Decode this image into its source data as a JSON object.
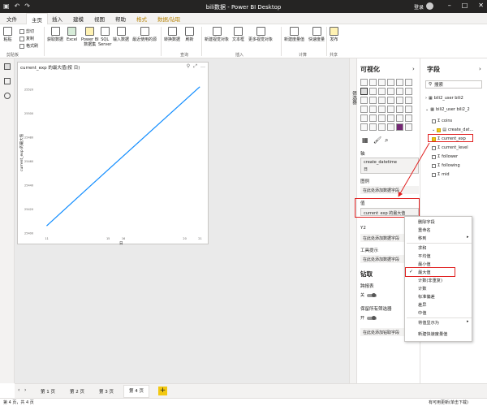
{
  "window": {
    "title": "bili数据 - Power BI Desktop",
    "login": "登录"
  },
  "tabs": [
    "文件",
    "主页",
    "插入",
    "建模",
    "视图",
    "帮助",
    "格式",
    "数据/钻取"
  ],
  "ribbon": {
    "paste": "粘贴",
    "cut": "剪切",
    "copy": "复制",
    "format_painter": "格式刷",
    "get_data": "获取数据",
    "excel": "Excel",
    "pbi_datasets": "Power BI\n数据集",
    "sql": "SQL\nServer",
    "enter_data": "输入数据",
    "recent": "最近使用的源",
    "transform": "转换数据",
    "refresh": "刷新",
    "new_visual": "新建视觉对象",
    "textbox": "文本框",
    "more_visuals": "更多视觉对象",
    "new_measure": "新建度量值",
    "quick_measure": "快速度量",
    "publish": "发布",
    "group_clipboard": "剪贴板",
    "group_query": "查询",
    "group_insert": "插入",
    "group_calc": "计算",
    "group_share": "共享"
  },
  "visual": {
    "title": "current_exp 的最大值(按 日)"
  },
  "chart_data": {
    "type": "line",
    "x": [
      11,
      14,
      15,
      16,
      17,
      18,
      19,
      20,
      21
    ],
    "y": [
      25420,
      25440,
      25450,
      25460,
      25470,
      25480,
      25490,
      25500,
      25510
    ],
    "xlabel": "日",
    "ylabel": "current_exp 的最大值",
    "xticks": [
      "11",
      "15",
      "16",
      "20",
      "21"
    ],
    "yticks": [
      "25400",
      "25420",
      "25440",
      "25460",
      "25480",
      "25500",
      "25520"
    ],
    "ylim": [
      25400,
      25530
    ],
    "series": [
      {
        "values": [
          [
            11,
            25406
          ],
          [
            14,
            25441
          ],
          [
            21,
            25522
          ]
        ]
      }
    ],
    "color": "#118dff"
  },
  "pages": [
    "第 1 页",
    "第 2 页",
    "第 3 页",
    "第 4 页"
  ],
  "status": {
    "left": "第 4 页，共 4 页",
    "right": "有可用更新(单击下载)"
  },
  "filters_label": "筛选器",
  "viz": {
    "title": "可视化",
    "axis_label": "轴",
    "axis_value": "create_datetime",
    "axis_sub": "日",
    "legend_label": "图例",
    "legend_placeholder": "在此处添加数据字段",
    "values_label": "值",
    "values_value": "current_exp 的最大值",
    "y2_label": "Y2",
    "y2_placeholder": "在此处添加数据字段",
    "tooltip_label": "工具提示",
    "tooltip_placeholder": "在此处添加数据字段",
    "drill_title": "钻取",
    "cross_report": "跨报表",
    "keep_filters": "保留所有筛选器",
    "drill_placeholder": "在此处添加钻取字段",
    "toggle_off": "关",
    "toggle_on": "开"
  },
  "fields": {
    "title": "字段",
    "search_placeholder": "搜索",
    "tables": [
      {
        "name": "bili2_user bili2"
      },
      {
        "name": "bili2_user bili2_2"
      }
    ],
    "items": [
      "coins",
      "create_dat...",
      "current_exp",
      "current_level",
      "follower",
      "following",
      "mid"
    ]
  },
  "context_menu": [
    "删除字段",
    "重命名",
    "移到",
    "求和",
    "平均值",
    "最小值",
    "最大值",
    "计数(非重复)",
    "计数",
    "标准偏差",
    "差异",
    "中值",
    "将值显示为",
    "新建快速度量值"
  ]
}
